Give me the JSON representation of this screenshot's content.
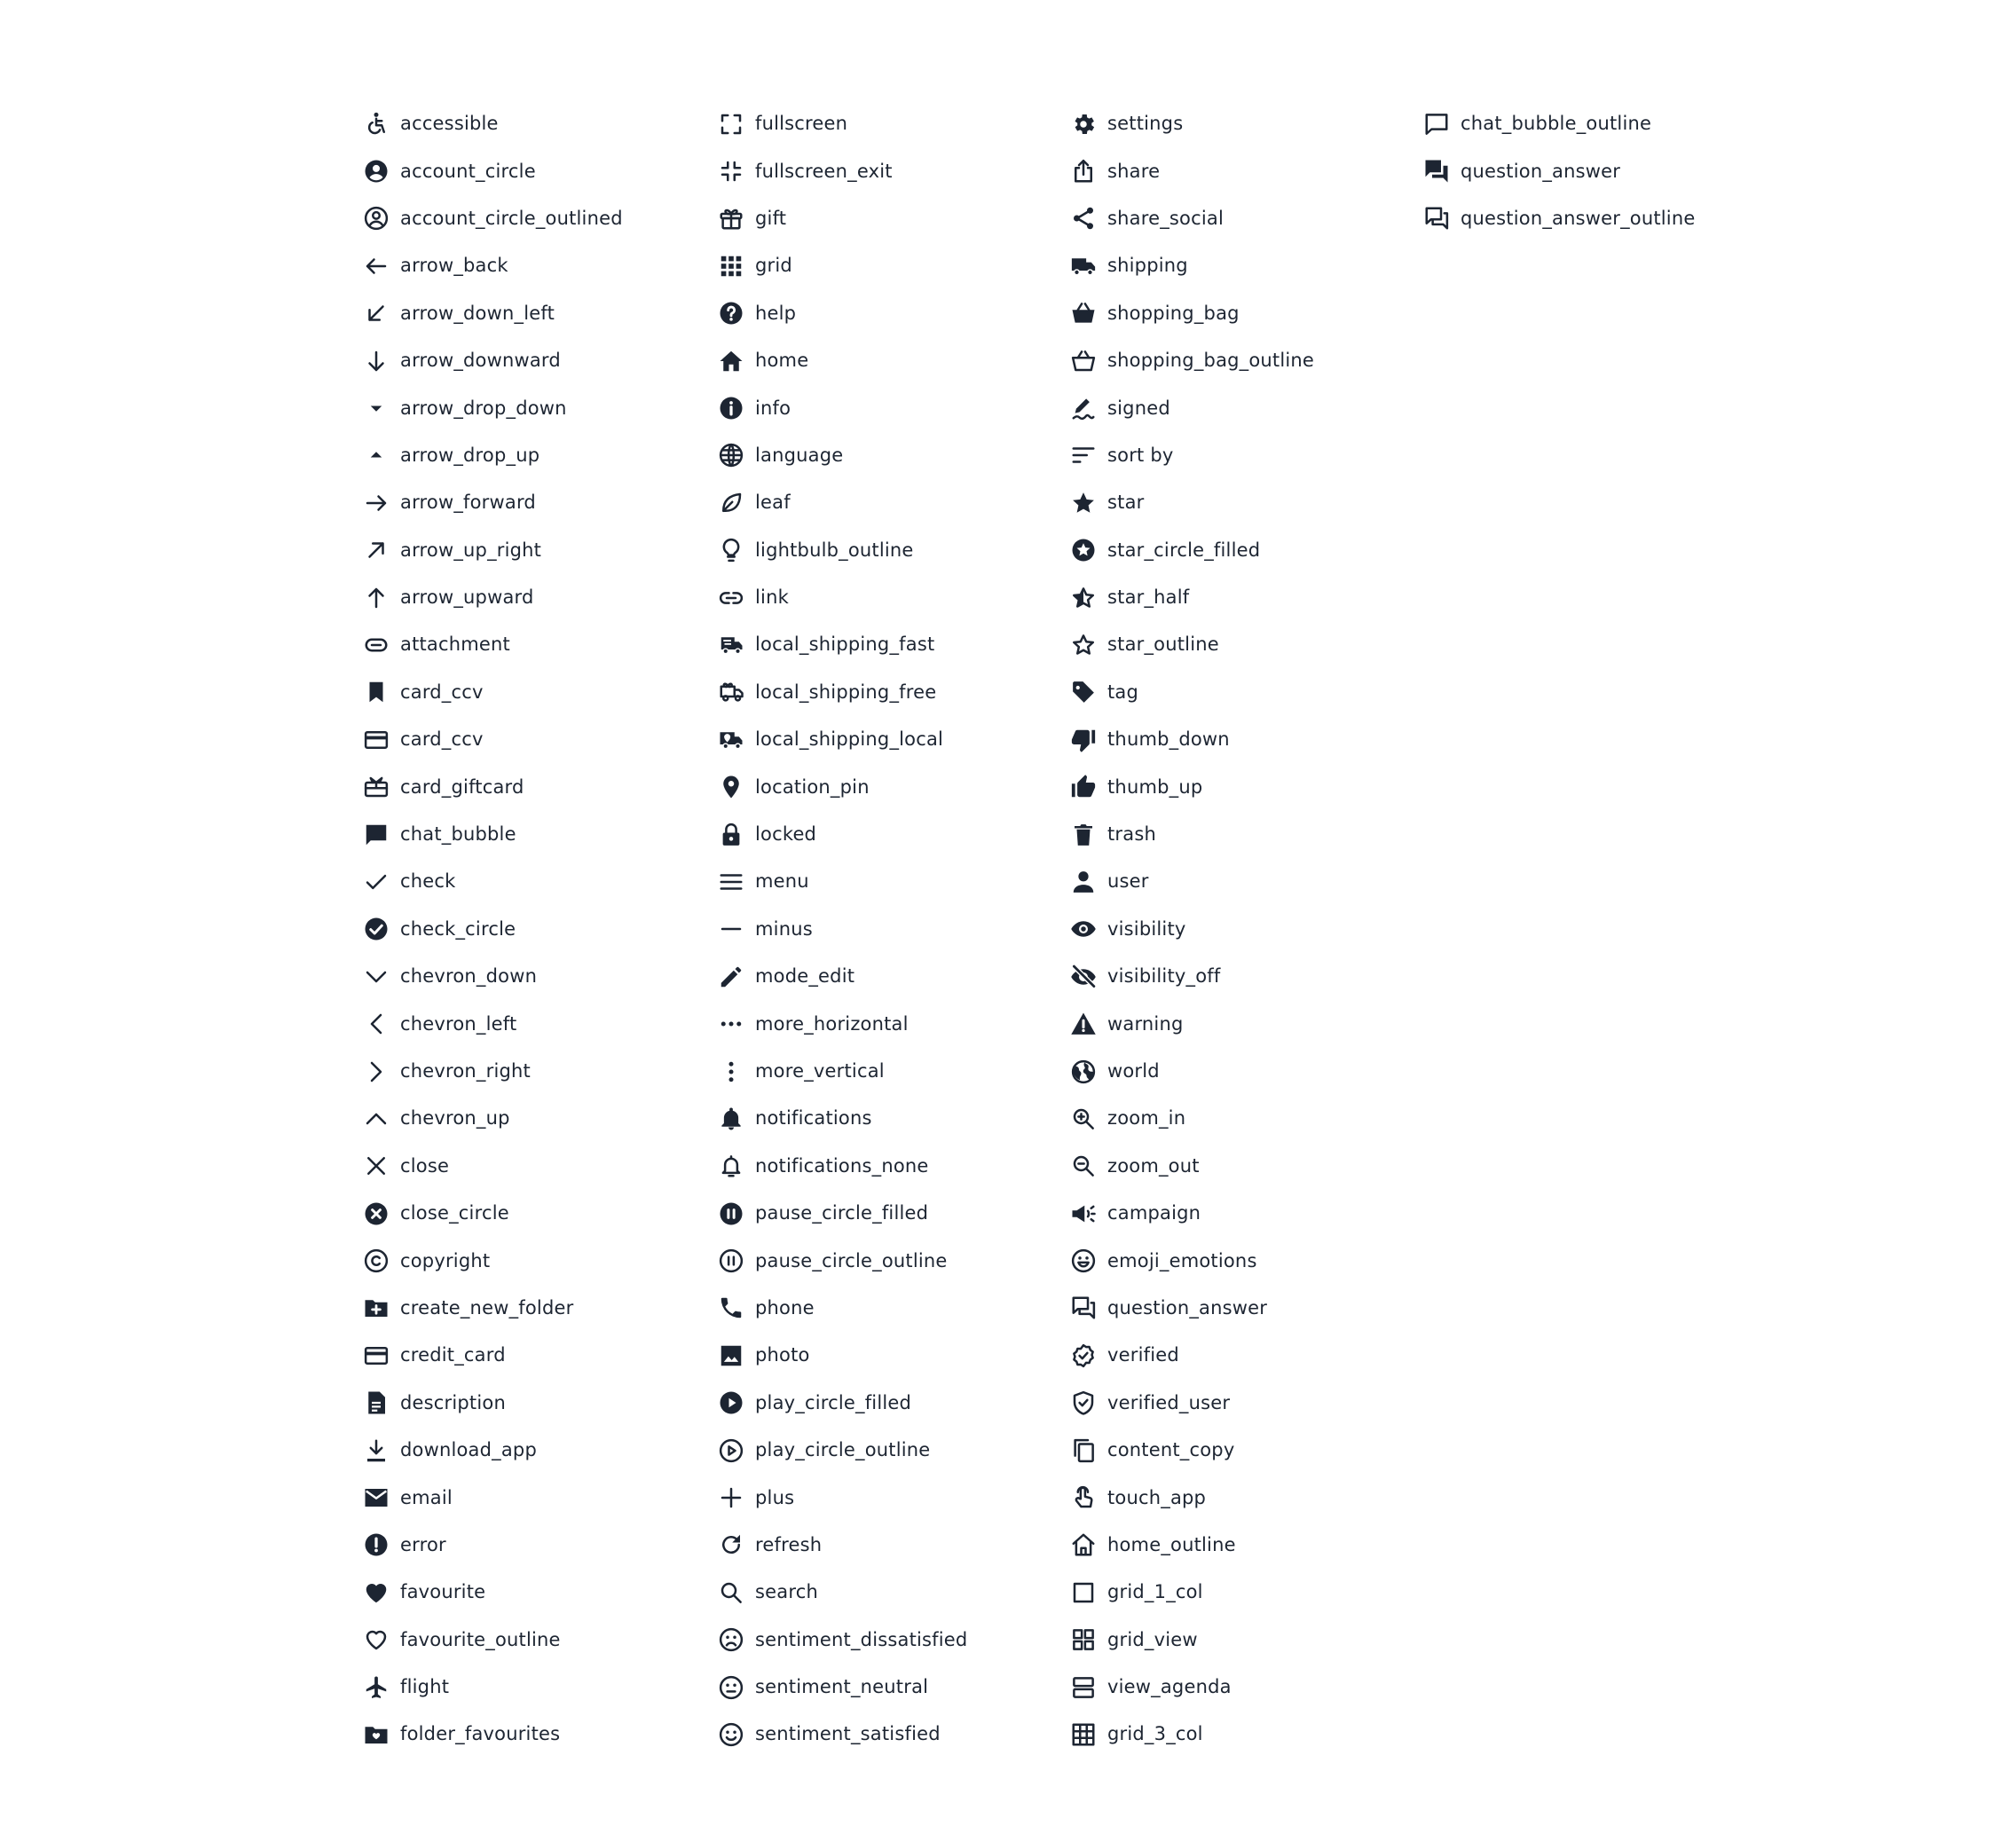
{
  "icon_color": "#1d2532",
  "background": "#ffffff",
  "columns": [
    [
      {
        "label": "accessible",
        "icon": "accessible"
      },
      {
        "label": "account_circle",
        "icon": "account_circle"
      },
      {
        "label": "account_circle_outlined",
        "icon": "account_circle_outlined"
      },
      {
        "label": "arrow_back",
        "icon": "arrow_back"
      },
      {
        "label": "arrow_down_left",
        "icon": "arrow_down_left"
      },
      {
        "label": "arrow_downward",
        "icon": "arrow_downward"
      },
      {
        "label": "arrow_drop_down",
        "icon": "arrow_drop_down"
      },
      {
        "label": "arrow_drop_up",
        "icon": "arrow_drop_up"
      },
      {
        "label": "arrow_forward",
        "icon": "arrow_forward"
      },
      {
        "label": "arrow_up_right",
        "icon": "arrow_up_right"
      },
      {
        "label": "arrow_upward",
        "icon": "arrow_upward"
      },
      {
        "label": "attachment",
        "icon": "attachment"
      },
      {
        "label": "card_ccv",
        "icon": "bookmark"
      },
      {
        "label": "card_ccv",
        "icon": "credit_card"
      },
      {
        "label": "card_giftcard",
        "icon": "card_giftcard"
      },
      {
        "label": "chat_bubble",
        "icon": "chat_bubble"
      },
      {
        "label": "check",
        "icon": "check"
      },
      {
        "label": "check_circle",
        "icon": "check_circle"
      },
      {
        "label": "chevron_down",
        "icon": "chevron_down"
      },
      {
        "label": "chevron_left",
        "icon": "chevron_left"
      },
      {
        "label": "chevron_right",
        "icon": "chevron_right"
      },
      {
        "label": "chevron_up",
        "icon": "chevron_up"
      },
      {
        "label": "close",
        "icon": "close"
      },
      {
        "label": "close_circle",
        "icon": "close_circle"
      },
      {
        "label": "copyright",
        "icon": "copyright"
      },
      {
        "label": "create_new_folder",
        "icon": "create_new_folder"
      },
      {
        "label": "credit_card",
        "icon": "credit_card"
      },
      {
        "label": "description",
        "icon": "description"
      },
      {
        "label": "download_app",
        "icon": "download_app"
      },
      {
        "label": "email",
        "icon": "email"
      },
      {
        "label": "error",
        "icon": "error"
      },
      {
        "label": "favourite",
        "icon": "favourite"
      },
      {
        "label": "favourite_outline",
        "icon": "favourite_outline"
      },
      {
        "label": "flight",
        "icon": "flight"
      },
      {
        "label": "folder_favourites",
        "icon": "folder_favourites"
      }
    ],
    [
      {
        "label": "fullscreen",
        "icon": "fullscreen"
      },
      {
        "label": "fullscreen_exit",
        "icon": "fullscreen_exit"
      },
      {
        "label": "gift",
        "icon": "gift"
      },
      {
        "label": "grid",
        "icon": "grid"
      },
      {
        "label": "help",
        "icon": "help"
      },
      {
        "label": "home",
        "icon": "home"
      },
      {
        "label": "info",
        "icon": "info"
      },
      {
        "label": "language",
        "icon": "language"
      },
      {
        "label": "leaf",
        "icon": "leaf"
      },
      {
        "label": "lightbulb_outline",
        "icon": "lightbulb_outline"
      },
      {
        "label": "link",
        "icon": "link"
      },
      {
        "label": "local_shipping_fast",
        "icon": "local_shipping_fast"
      },
      {
        "label": "local_shipping_free",
        "icon": "local_shipping_free"
      },
      {
        "label": "local_shipping_local",
        "icon": "local_shipping_local"
      },
      {
        "label": "location_pin",
        "icon": "location_pin"
      },
      {
        "label": "locked",
        "icon": "locked"
      },
      {
        "label": "menu",
        "icon": "menu"
      },
      {
        "label": "minus",
        "icon": "minus"
      },
      {
        "label": "mode_edit",
        "icon": "mode_edit"
      },
      {
        "label": "more_horizontal",
        "icon": "more_horizontal"
      },
      {
        "label": "more_vertical",
        "icon": "more_vertical"
      },
      {
        "label": "notifications",
        "icon": "notifications"
      },
      {
        "label": "notifications_none",
        "icon": "notifications_none"
      },
      {
        "label": "pause_circle_filled",
        "icon": "pause_circle_filled"
      },
      {
        "label": "pause_circle_outline",
        "icon": "pause_circle_outline"
      },
      {
        "label": "phone",
        "icon": "phone"
      },
      {
        "label": "photo",
        "icon": "photo"
      },
      {
        "label": "play_circle_filled",
        "icon": "play_circle_filled"
      },
      {
        "label": "play_circle_outline",
        "icon": "play_circle_outline"
      },
      {
        "label": "plus",
        "icon": "plus"
      },
      {
        "label": "refresh",
        "icon": "refresh"
      },
      {
        "label": "search",
        "icon": "search"
      },
      {
        "label": "sentiment_dissatisfied",
        "icon": "sentiment_dissatisfied"
      },
      {
        "label": "sentiment_neutral",
        "icon": "sentiment_neutral"
      },
      {
        "label": "sentiment_satisfied",
        "icon": "sentiment_satisfied"
      }
    ],
    [
      {
        "label": "settings",
        "icon": "settings"
      },
      {
        "label": "share",
        "icon": "share"
      },
      {
        "label": "share_social",
        "icon": "share_social"
      },
      {
        "label": "shipping",
        "icon": "shipping"
      },
      {
        "label": "shopping_bag",
        "icon": "shopping_bag"
      },
      {
        "label": "shopping_bag_outline",
        "icon": "shopping_bag_outline"
      },
      {
        "label": "signed",
        "icon": "signed"
      },
      {
        "label": "sort by",
        "icon": "sort"
      },
      {
        "label": "star",
        "icon": "star"
      },
      {
        "label": "star_circle_filled",
        "icon": "star_circle_filled"
      },
      {
        "label": "star_half",
        "icon": "star_half"
      },
      {
        "label": "star_outline",
        "icon": "star_outline"
      },
      {
        "label": "tag",
        "icon": "tag"
      },
      {
        "label": "thumb_down",
        "icon": "thumb_down"
      },
      {
        "label": "thumb_up",
        "icon": "thumb_up"
      },
      {
        "label": "trash",
        "icon": "trash"
      },
      {
        "label": "user",
        "icon": "user"
      },
      {
        "label": "visibility",
        "icon": "visibility"
      },
      {
        "label": "visibility_off",
        "icon": "visibility_off"
      },
      {
        "label": "warning",
        "icon": "warning"
      },
      {
        "label": "world",
        "icon": "world"
      },
      {
        "label": "zoom_in",
        "icon": "zoom_in"
      },
      {
        "label": "zoom_out",
        "icon": "zoom_out"
      },
      {
        "label": "campaign",
        "icon": "campaign"
      },
      {
        "label": "emoji_emotions",
        "icon": "emoji_emotions"
      },
      {
        "label": "question_answer",
        "icon": "question_answer_outline"
      },
      {
        "label": "verified",
        "icon": "verified"
      },
      {
        "label": "verified_user",
        "icon": "verified_user"
      },
      {
        "label": "content_copy",
        "icon": "content_copy"
      },
      {
        "label": "touch_app",
        "icon": "touch_app"
      },
      {
        "label": "home_outline",
        "icon": "home_outline"
      },
      {
        "label": "grid_1_col",
        "icon": "grid_1_col"
      },
      {
        "label": "grid_view",
        "icon": "grid_view"
      },
      {
        "label": "view_agenda",
        "icon": "view_agenda"
      },
      {
        "label": "grid_3_col",
        "icon": "grid_3_col"
      }
    ],
    [
      {
        "label": "chat_bubble_outline",
        "icon": "chat_bubble_outline"
      },
      {
        "label": "question_answer",
        "icon": "question_answer"
      },
      {
        "label": "question_answer_outline",
        "icon": "question_answer_outline"
      }
    ]
  ]
}
